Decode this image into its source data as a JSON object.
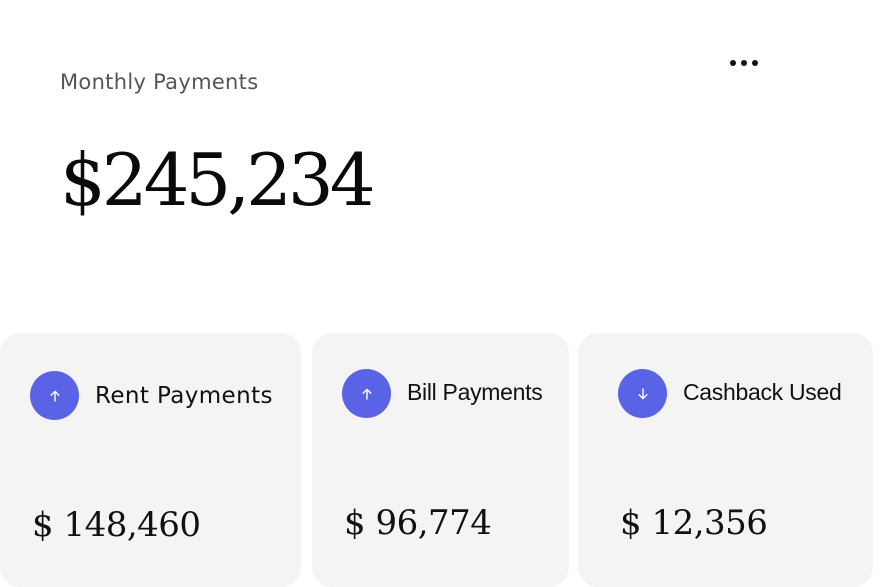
{
  "header": {
    "title": "Monthly Payments",
    "total": "$245,234",
    "more_icon": "more-horizontal-icon"
  },
  "colors": {
    "accent": "#5a62e6",
    "card_background": "#f4f4f4",
    "text_primary": "#111111",
    "text_secondary": "#555555"
  },
  "cards": [
    {
      "label": "Rent Payments",
      "value": "$ 148,460",
      "icon": "arrow-up-icon"
    },
    {
      "label": "Bill Payments",
      "value": "$ 96,774",
      "icon": "arrow-up-icon"
    },
    {
      "label": "Cashback Used",
      "value": "$ 12,356",
      "icon": "arrow-down-icon"
    }
  ]
}
